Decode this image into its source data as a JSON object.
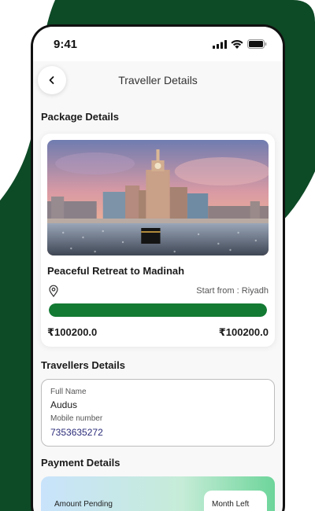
{
  "status_bar": {
    "time": "9:41"
  },
  "nav": {
    "title": "Traveller Details"
  },
  "package_section": {
    "title": "Package Details",
    "package_name": "Peaceful Retreat to Madinah",
    "start_from": "Start from : Riyadh",
    "progress_fraction": 1.0,
    "price_left": "₹100200.0",
    "price_right": "₹100200.0"
  },
  "travellers_section": {
    "title": "Travellers Details",
    "full_name_label": "Full Name",
    "full_name_value": "Audus",
    "mobile_label": "Mobile number",
    "mobile_value": "7353635272"
  },
  "payment_section": {
    "title": "Payment Details",
    "amount_pending_label": "Amount Pending",
    "month_left_label": "Month Left"
  },
  "colors": {
    "brand_green": "#0d4a26",
    "progress_green": "#137a33"
  },
  "icons": [
    "signal-icon",
    "wifi-icon",
    "battery-icon",
    "back-arrow-icon",
    "location-pin-icon"
  ]
}
